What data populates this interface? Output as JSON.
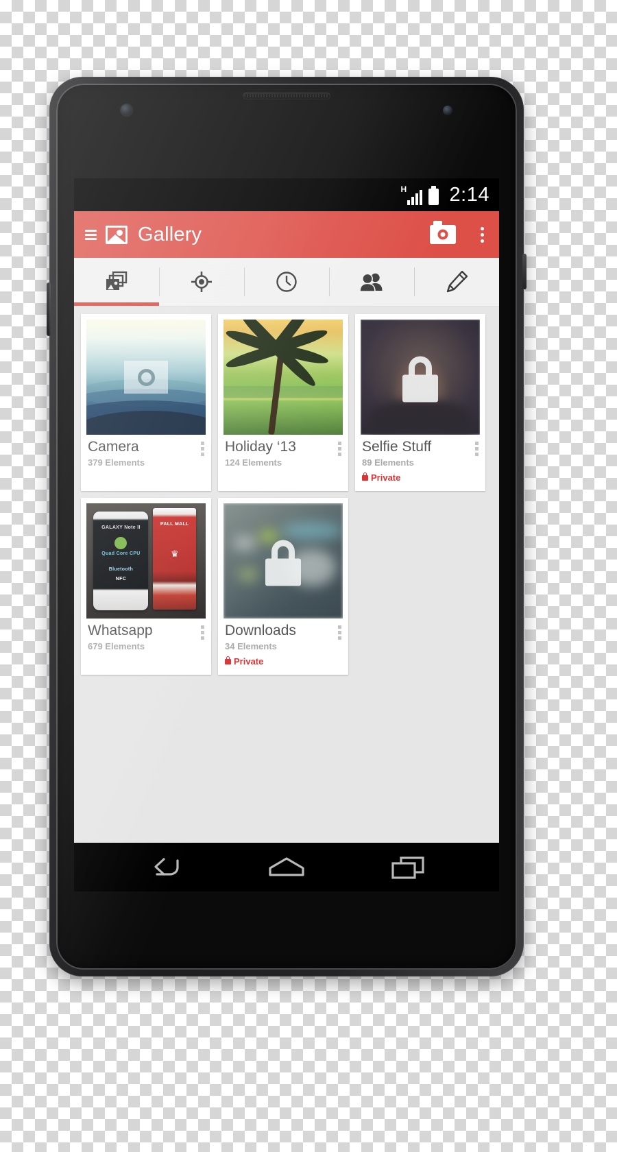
{
  "device": {
    "name": "android-phone-mockup",
    "frame_color": "#262628"
  },
  "statusbar": {
    "network_type": "H",
    "signal_icon": "signal-bars-icon",
    "battery_icon": "battery-icon",
    "time": "2:14"
  },
  "actionbar": {
    "accent_color": "#dd5048",
    "menu_icon": "hamburger-menu-icon",
    "app_icon": "gallery-image-icon",
    "title": "Gallery",
    "camera_icon": "camera-icon",
    "overflow_icon": "overflow-menu-icon"
  },
  "tabs": [
    {
      "label": "Albums",
      "icon": "photo-stack-icon",
      "active": true
    },
    {
      "label": "Locations",
      "icon": "location-target-icon",
      "active": false
    },
    {
      "label": "Times",
      "icon": "clock-icon",
      "active": false
    },
    {
      "label": "People",
      "icon": "people-icon",
      "active": false
    },
    {
      "label": "Tags",
      "icon": "pencil-tag-icon",
      "active": false
    }
  ],
  "albums": [
    {
      "title": "Camera",
      "count": "379 Elements",
      "private": false,
      "private_label": "",
      "thumb": "misty-mountains-photo",
      "overlay_icon": "camera-overlay-icon",
      "menu_icon": "card-overflow-icon"
    },
    {
      "title": "Holiday ‘13",
      "count": "124 Elements",
      "private": false,
      "private_label": "",
      "thumb": "palm-tree-beach-photo",
      "overlay_icon": "",
      "menu_icon": "card-overflow-icon"
    },
    {
      "title": "Selfie Stuff",
      "count": "89 Elements",
      "private": true,
      "private_label": "Private",
      "thumb": "blurred-portrait-photo",
      "overlay_icon": "lock-overlay-icon",
      "menu_icon": "card-overflow-icon"
    },
    {
      "title": "Whatsapp",
      "count": "679 Elements",
      "private": false,
      "private_label": "",
      "thumb": "phone-and-cigarettes-photo",
      "overlay_icon": "",
      "menu_icon": "card-overflow-icon"
    },
    {
      "title": "Downloads",
      "count": "34 Elements",
      "private": true,
      "private_label": "Private",
      "thumb": "blurred-desk-photo",
      "overlay_icon": "lock-overlay-icon",
      "menu_icon": "card-overflow-icon"
    }
  ],
  "navbar": [
    {
      "label": "Back",
      "icon": "back-arrow-icon"
    },
    {
      "label": "Home",
      "icon": "home-icon"
    },
    {
      "label": "Recents",
      "icon": "recents-icon"
    }
  ],
  "colors": {
    "accent": "#dd5048",
    "private": "#dd3333",
    "content_bg": "#e6e6e6",
    "tab_bg": "#f1f1f1"
  },
  "thumb_text": {
    "wa_model": "GALAXY Note II",
    "wa_cpu": "Quad Core CPU",
    "wa_bt": "Bluetooth",
    "wa_nfc": "NFC",
    "cig_brand": "PALL MALL"
  }
}
